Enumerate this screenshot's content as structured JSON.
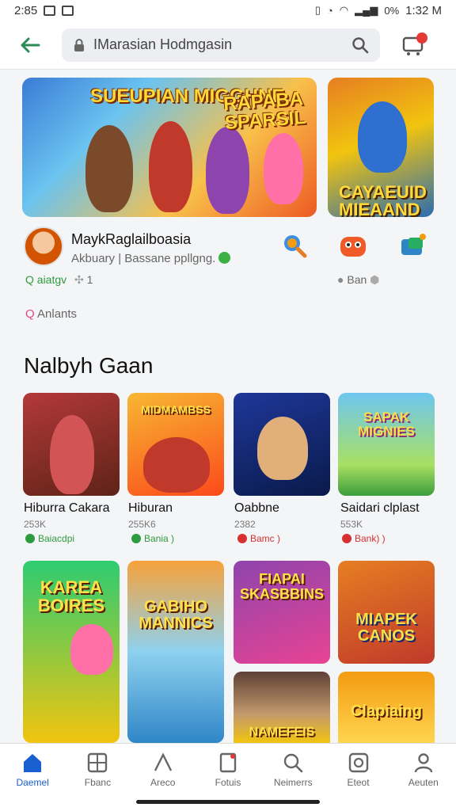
{
  "status_bar": {
    "time": "2:85",
    "right_text": "0%",
    "clock": "1:32 M"
  },
  "search": {
    "value": "IMarasian Hodmgasin"
  },
  "banners": {
    "main_title_left": "SUEUPIAN MIGGHNE",
    "main_title_right": "RAPABA SPARSIL",
    "side_title": "CAYAEUID MIEAAND"
  },
  "developer": {
    "name": "MaykRaglailboasia",
    "subtitle": "Akbuary | Bassane ppllgng.",
    "rating_label": "aiatgv",
    "rating_count": "1",
    "right_stat": "Ban",
    "tag": "Anlants"
  },
  "section": {
    "title": "Nalbyh Gaan"
  },
  "games": [
    {
      "name": "Hiburra Cakara",
      "size": "253K",
      "tag": "Baiacdpi",
      "tag_color": "#2e9b3e",
      "art": "",
      "colors": [
        "#c0392b",
        "#6e2c1c"
      ]
    },
    {
      "name": "Hiburan",
      "size": "255K6",
      "tag": "Bania )",
      "tag_color": "#2e9b3e",
      "art": "MIDMAMBSS",
      "colors": [
        "#f39c12",
        "#e74c3c"
      ]
    },
    {
      "name": "Oabbne",
      "size": "2382",
      "tag": "Bamc )",
      "tag_color": "#d63031",
      "art": "",
      "colors": [
        "#1e3799",
        "#0a1a4a"
      ]
    },
    {
      "name": "Saidari clplast",
      "size": "553K",
      "tag": "Bank) )",
      "tag_color": "#d63031",
      "art": "SAPAK MIGNIES",
      "colors": [
        "#6ec6f0",
        "#3c9c3c"
      ]
    }
  ],
  "games_row2": [
    {
      "art": "KAREA BOIRES",
      "colors": [
        "#2ecc71",
        "#f1c40f"
      ]
    },
    {
      "art": "GABIHO MANNICS",
      "colors": [
        "#f6a23b",
        "#2f86c7"
      ]
    },
    {
      "art": "FIAPAI SKASBBINS",
      "colors": [
        "#8e44ad",
        "#e84393"
      ]
    },
    {
      "art": "MIAPEK CANOS",
      "colors": [
        "#e67e22",
        "#c0392b"
      ]
    }
  ],
  "games_row2_extra": [
    {
      "art": "NAMEFEIS",
      "colors": [
        "#5d4037",
        "#f1c40f"
      ]
    },
    {
      "art": "Clapiaing",
      "colors": [
        "#f39c12",
        "#ffd54f"
      ]
    }
  ],
  "bottom_nav": [
    {
      "label": "Daemel",
      "icon": "home-icon",
      "active": true
    },
    {
      "label": "Fbanc",
      "icon": "grid-icon",
      "active": false
    },
    {
      "label": "Areco",
      "icon": "shape-icon",
      "active": false
    },
    {
      "label": "Fotuis",
      "icon": "news-icon",
      "active": false
    },
    {
      "label": "Neimerrs",
      "icon": "search-icon",
      "active": false
    },
    {
      "label": "Eteot",
      "icon": "camera-icon",
      "active": false
    },
    {
      "label": "Aeuten",
      "icon": "profile-icon",
      "active": false
    }
  ],
  "colors": {
    "accent": "#1a5fd0",
    "back": "#2e8b57",
    "badge": "#e53935"
  }
}
